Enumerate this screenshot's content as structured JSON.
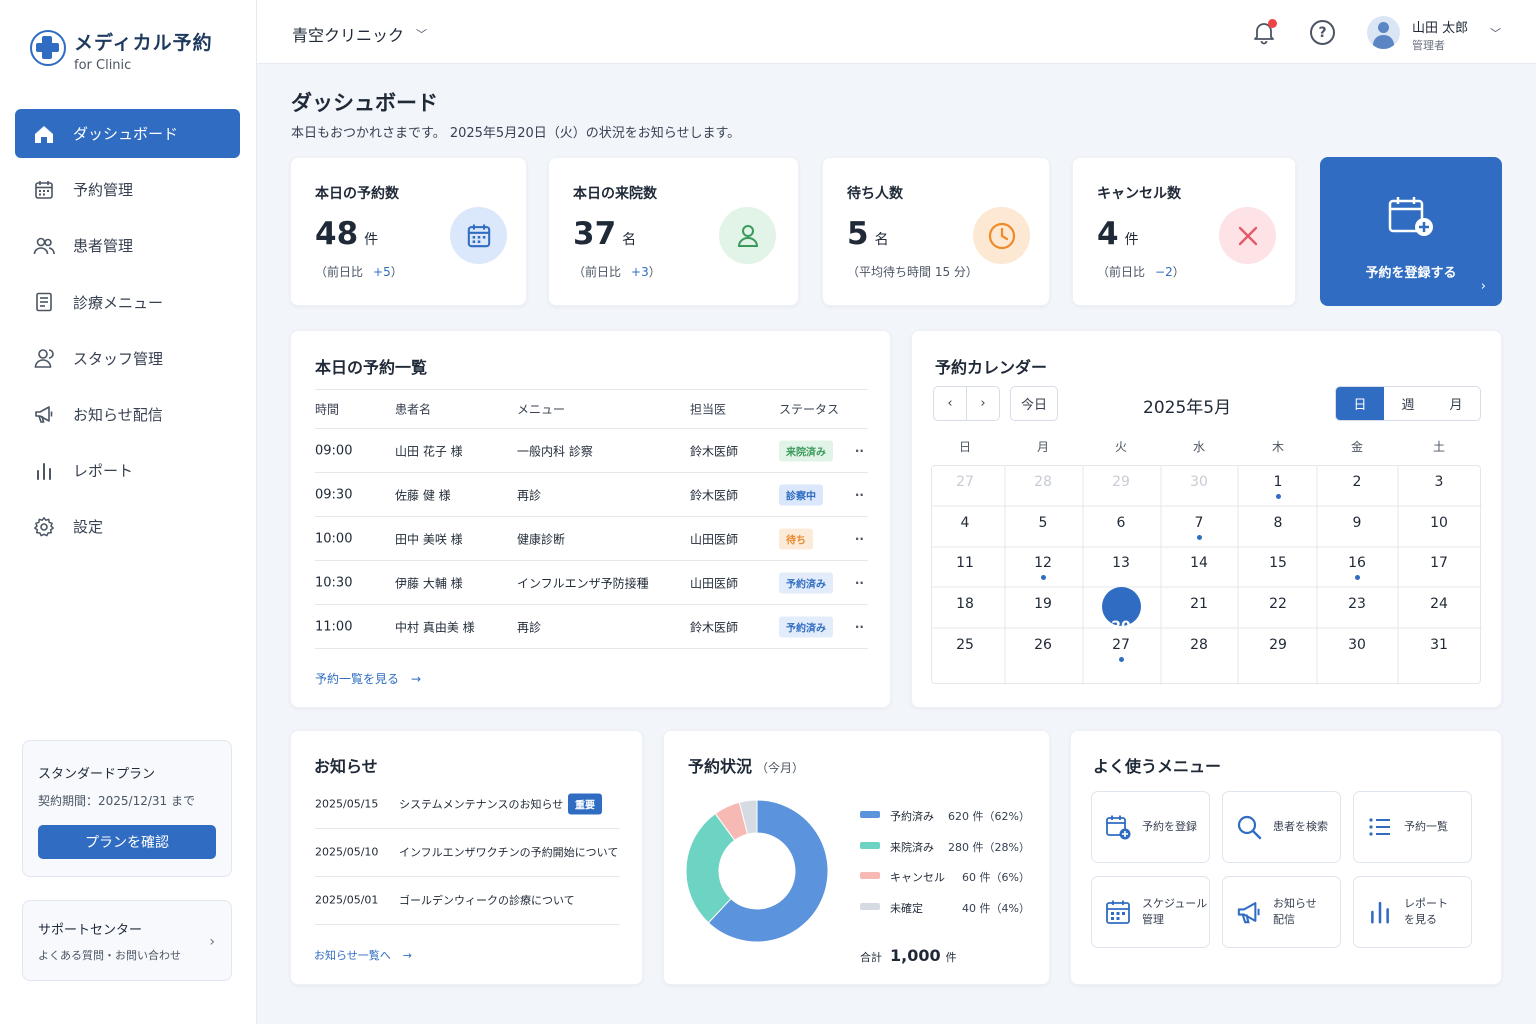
{
  "app": {
    "title": "メディカル予約",
    "subtitle": "for Clinic"
  },
  "nav": [
    {
      "label": "ダッシュボード",
      "icon": "home-icon",
      "active": true
    },
    {
      "label": "予約管理",
      "icon": "calendar-icon"
    },
    {
      "label": "患者管理",
      "icon": "users-icon"
    },
    {
      "label": "診療メニュー",
      "icon": "document-icon"
    },
    {
      "label": "スタッフ管理",
      "icon": "staff-icon"
    },
    {
      "label": "お知らせ配信",
      "icon": "megaphone-icon"
    },
    {
      "label": "レポート",
      "icon": "bar-chart-icon"
    },
    {
      "label": "設定",
      "icon": "gear-icon"
    }
  ],
  "plan": {
    "name": "スタンダードプラン",
    "period": "契約期間：2025/12/31 まで",
    "button": "プランを確認"
  },
  "support": {
    "title": "サポートセンター",
    "sub": "よくある質問・お問い合わせ"
  },
  "header": {
    "clinic": "青空クリニック",
    "user_name": "山田 太郎",
    "user_role": "管理者"
  },
  "page": {
    "title": "ダッシュボード",
    "subtitle": "本日もおつかれさまです。 2025年5月20日（火）の状況をお知らせします。"
  },
  "stats": [
    {
      "label": "本日の予約数",
      "value": "48",
      "unit": "件",
      "sub_prefix": "（前日比",
      "sub_value": "+5",
      "sub_suffix": "）"
    },
    {
      "label": "本日の来院数",
      "value": "37",
      "unit": "名",
      "sub_prefix": "（前日比",
      "sub_value": "+3",
      "sub_suffix": "）"
    },
    {
      "label": "待ち人数",
      "value": "5",
      "unit": "名",
      "sub_prefix": "（平均待ち時間 15 分）",
      "sub_value": "",
      "sub_suffix": ""
    },
    {
      "label": "キャンセル数",
      "value": "4",
      "unit": "件",
      "sub_prefix": "（前日比",
      "sub_value": "−2",
      "sub_suffix": "）"
    }
  ],
  "register_card": {
    "label": "予約を登録する"
  },
  "appointments": {
    "title": "本日の予約一覧",
    "columns": [
      "時間",
      "患者名",
      "メニュー",
      "担当医",
      "ステータス"
    ],
    "rows": [
      {
        "time": "09:00",
        "patient": "山田 花子 様",
        "menu": "一般内科 診察",
        "doctor": "鈴木医師",
        "status": "来院済み"
      },
      {
        "time": "09:30",
        "patient": "佐藤 健 様",
        "menu": "再診",
        "doctor": "鈴木医師",
        "status": "診察中"
      },
      {
        "time": "10:00",
        "patient": "田中 美咲 様",
        "menu": "健康診断",
        "doctor": "山田医師",
        "status": "待ち"
      },
      {
        "time": "10:30",
        "patient": "伊藤 大輔 様",
        "menu": "インフルエンザ予防接種",
        "doctor": "山田医師",
        "status": "予約済み"
      },
      {
        "time": "11:00",
        "patient": "中村 真由美 様",
        "menu": "再診",
        "doctor": "鈴木医師",
        "status": "予約済み"
      }
    ],
    "more": "予約一覧を見る"
  },
  "calendar": {
    "title": "予約カレンダー",
    "today_btn": "今日",
    "month": "2025年5月",
    "views": [
      "日",
      "週",
      "月"
    ],
    "weekdays": [
      "日",
      "月",
      "火",
      "水",
      "木",
      "金",
      "土"
    ],
    "days": [
      "27",
      "28",
      "29",
      "30",
      "1",
      "2",
      "3",
      "4",
      "5",
      "6",
      "7",
      "8",
      "9",
      "10",
      "11",
      "12",
      "13",
      "14",
      "15",
      "16",
      "17",
      "18",
      "19",
      "20",
      "21",
      "22",
      "23",
      "24",
      "25",
      "26",
      "27",
      "28",
      "29",
      "30",
      "31"
    ],
    "event_days": [
      "1",
      "7",
      "12",
      "16",
      "20",
      "27"
    ],
    "today": "20"
  },
  "news": {
    "title": "お知らせ",
    "items": [
      {
        "date": "2025/05/15",
        "text": "システムメンテナンスのお知らせ",
        "badge": "重要"
      },
      {
        "date": "2025/05/10",
        "text": "インフルエンザワクチンの予約開始について",
        "badge": ""
      },
      {
        "date": "2025/05/01",
        "text": "ゴールデンウィークの診療について",
        "badge": ""
      }
    ],
    "more": "お知らせ一覧へ"
  },
  "status_chart": {
    "title": "予約状況",
    "period": "（今月）",
    "total_label": "合計",
    "total_value": "1,000",
    "total_unit": "件"
  },
  "chart_data": {
    "type": "pie",
    "categories": [
      "予約済み",
      "来院済み",
      "キャンセル",
      "未確定"
    ],
    "values": [
      620,
      280,
      60,
      40
    ],
    "labels": [
      "620 件（62%）",
      "280 件（28%）",
      "60 件（6%）",
      "40 件（4%）"
    ],
    "colors": [
      "#5b93dc",
      "#6dd3c2",
      "#f7b9b4",
      "#d6dbe3"
    ]
  },
  "quick_menu": {
    "title": "よく使うメニュー",
    "items": [
      {
        "label": "予約を登録",
        "icon": "calendar-plus-icon"
      },
      {
        "label": "患者を検索",
        "icon": "search-icon"
      },
      {
        "label": "予約一覧",
        "icon": "list-icon"
      },
      {
        "label": "スケジュール\n管理",
        "icon": "schedule-icon"
      },
      {
        "label": "お知らせ\n配信",
        "icon": "megaphone-icon"
      },
      {
        "label": "レポート\nを見る",
        "icon": "bar-chart-icon"
      }
    ]
  }
}
